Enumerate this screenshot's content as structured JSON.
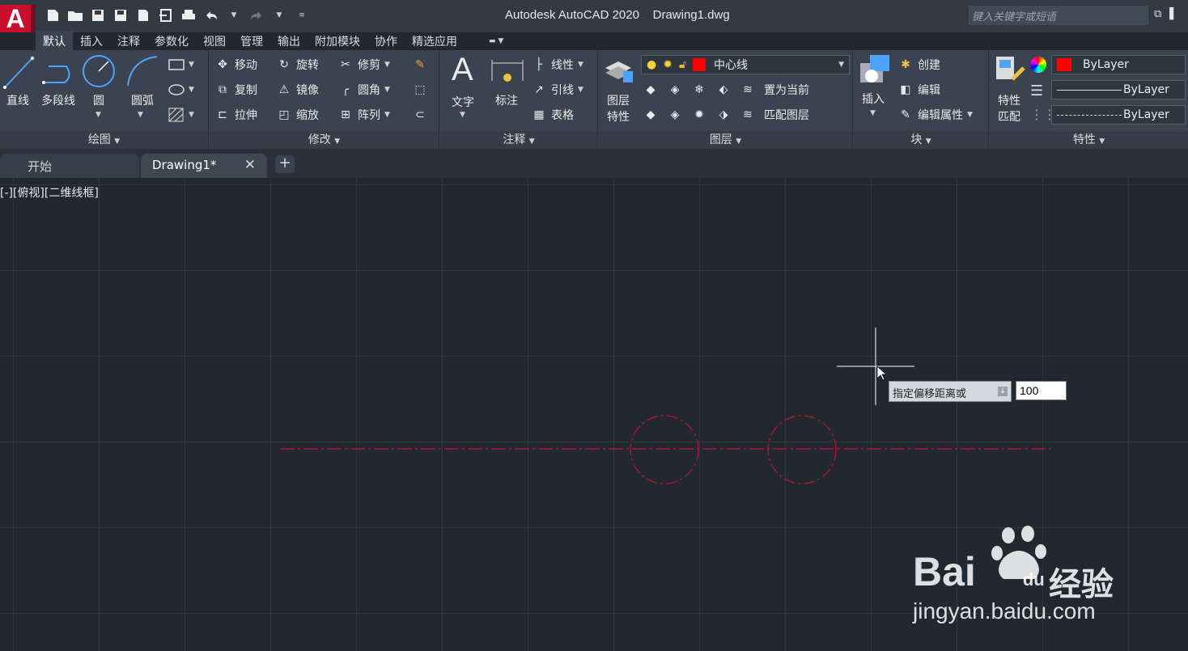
{
  "app": {
    "logo_letter": "A",
    "title": "Autodesk AutoCAD 2020    Drawing1.dwg",
    "search_placeholder": "键入关键字或短语"
  },
  "ribbon_tabs": [
    "默认",
    "插入",
    "注释",
    "参数化",
    "视图",
    "管理",
    "输出",
    "附加模块",
    "协作",
    "精选应用"
  ],
  "panels": {
    "draw": {
      "title": "绘图",
      "line": "直线",
      "polyline": "多段线",
      "circle": "圆",
      "arc": "圆弧"
    },
    "modify": {
      "title": "修改",
      "move": "移动",
      "rotate": "旋转",
      "trim": "修剪",
      "copy": "复制",
      "mirror": "镜像",
      "fillet": "圆角",
      "stretch": "拉伸",
      "scale": "缩放",
      "array": "阵列"
    },
    "annotation": {
      "title": "注释",
      "text": "文字",
      "dimension": "标注",
      "linear": "线性",
      "leader": "引线",
      "table": "表格"
    },
    "layers": {
      "title": "图层",
      "layer_properties_1": "图层",
      "layer_properties_2": "特性",
      "current_layer": "中心线",
      "current_layer_color": "#ff0000",
      "set_current": "置为当前",
      "match_layer": "匹配图层"
    },
    "block": {
      "title": "块",
      "insert": "插入",
      "create": "创建",
      "edit": "编辑",
      "edit_attributes": "编辑属性"
    },
    "properties": {
      "title": "特性",
      "match_1": "特性",
      "match_2": "匹配",
      "color": "ByLayer",
      "lineweight": "ByLayer",
      "linetype": "ByLayer",
      "color_swatch": "#ff0000"
    }
  },
  "file_tabs": {
    "start": "开始",
    "drawing": "Drawing1*"
  },
  "viewport_label": "[-][俯视][二维线框]",
  "command": {
    "prompt": "指定偏移距离或",
    "value": "100"
  },
  "watermark": {
    "brand": "Bai",
    "brand2": "du",
    "cn": "经验",
    "url": "jingyan.baidu.com"
  },
  "colors": {
    "centerline": "#c8102e",
    "accent_red": "#c8102e"
  }
}
